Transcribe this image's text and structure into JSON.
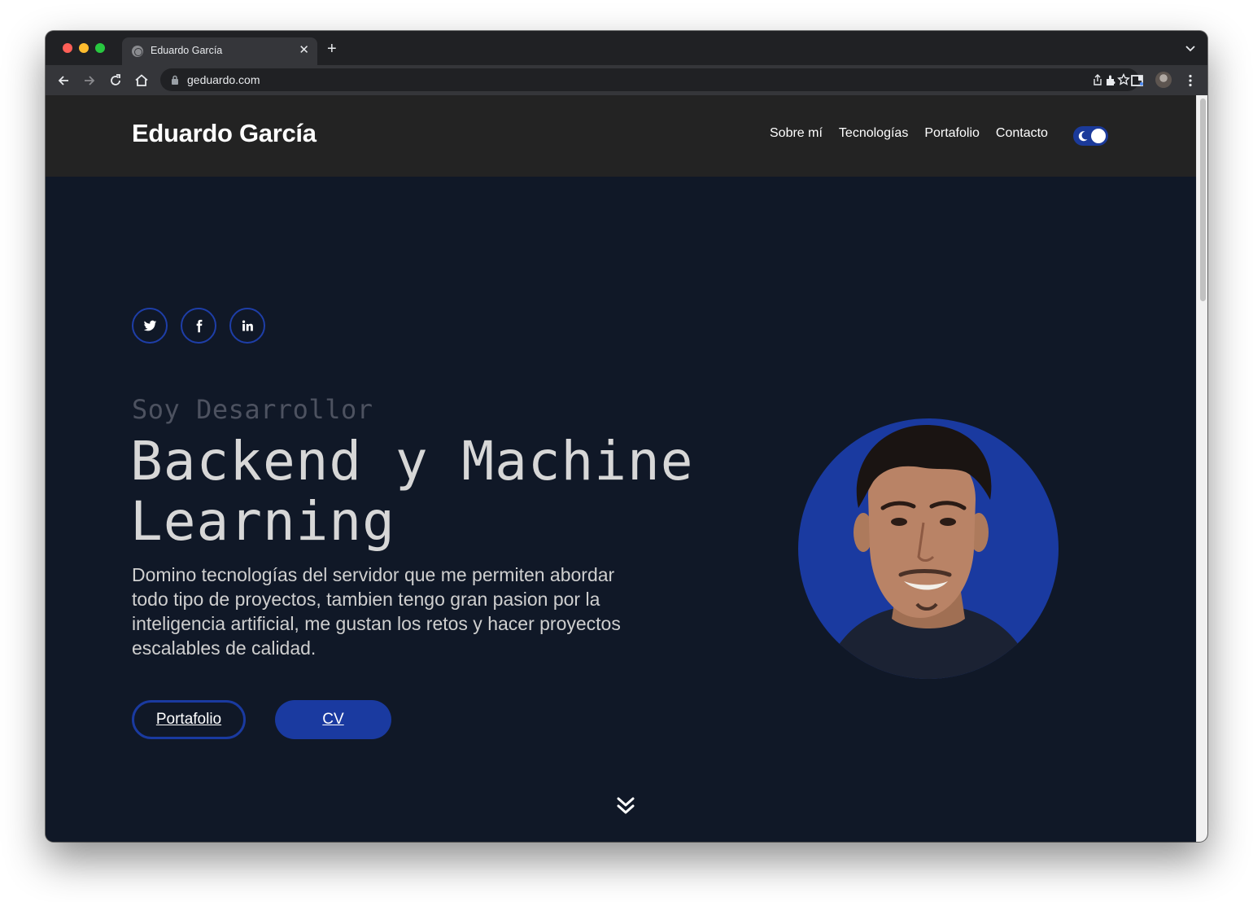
{
  "browser": {
    "tab_title": "Eduardo García",
    "url": "geduardo.com"
  },
  "site": {
    "brand": "Eduardo García",
    "nav": [
      {
        "label": "Sobre mí"
      },
      {
        "label": "Tecnologías"
      },
      {
        "label": "Portafolio"
      },
      {
        "label": "Contacto"
      }
    ]
  },
  "hero": {
    "pre_title": "Soy Desarrollor",
    "title": "Backend y Machine Learning",
    "description": "Domino tecnologías del servidor que me permiten abordar todo tipo de proyectos, tambien tengo gran pasion por la inteligencia artificial, me gustan los retos y hacer proyectos escalables de calidad.",
    "buttons": {
      "portfolio_label": "Portafolio",
      "cv_label": "CV"
    },
    "socials": [
      {
        "icon": "twitter-icon"
      },
      {
        "icon": "facebook-icon"
      },
      {
        "icon": "linkedin-icon"
      }
    ]
  },
  "colors": {
    "page_background": "#101827",
    "header_background": "#232323",
    "accent": "#1a3aa0"
  }
}
